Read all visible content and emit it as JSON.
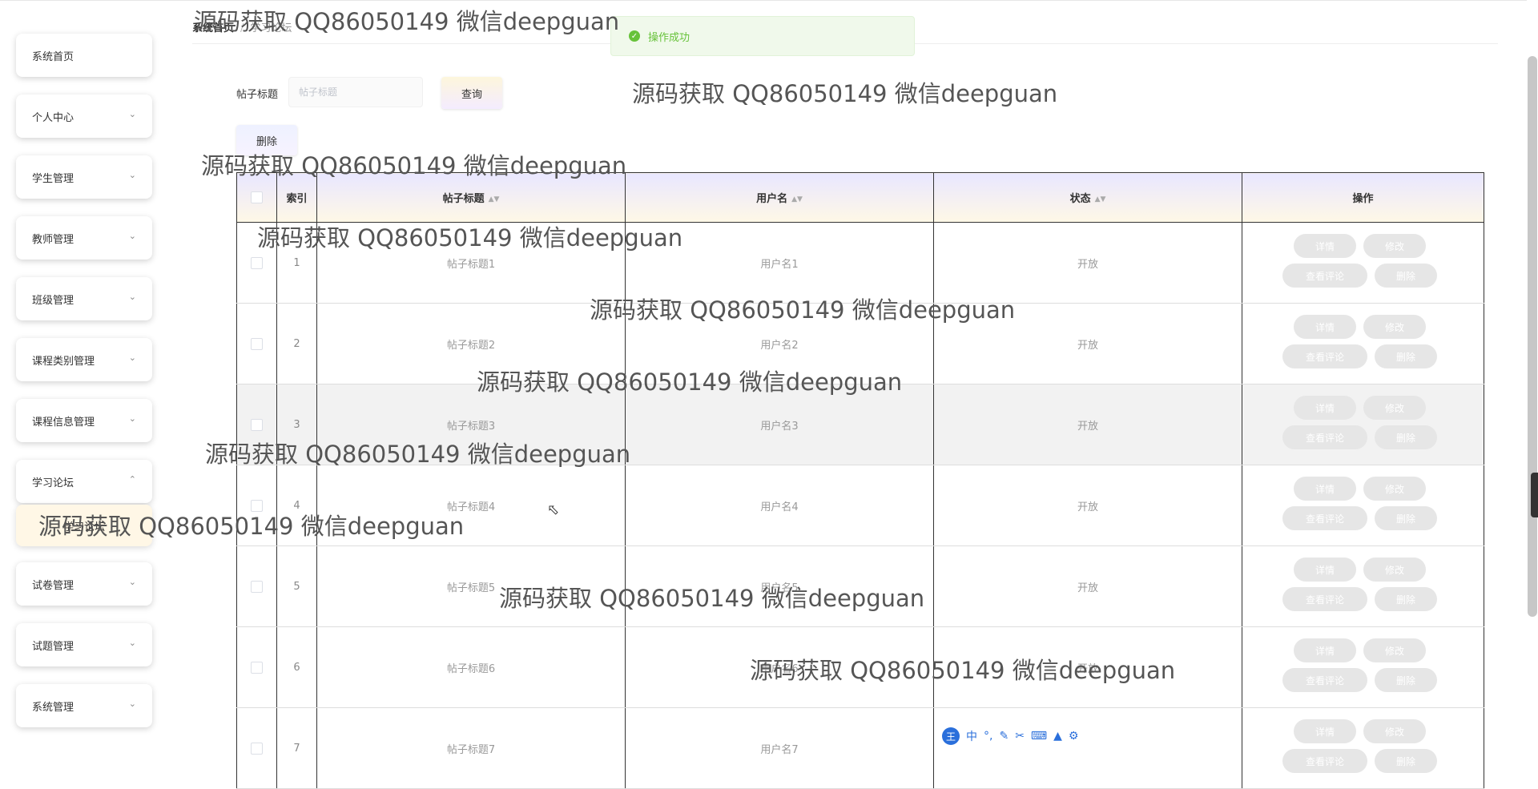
{
  "breadcrumb": {
    "home": "系统首页",
    "current": "学习论坛"
  },
  "toast": {
    "text": "操作成功"
  },
  "sidebar": {
    "items": [
      {
        "label": "系统首页",
        "has_arrow": false
      },
      {
        "label": "个人中心",
        "has_arrow": true
      },
      {
        "label": "学生管理",
        "has_arrow": true
      },
      {
        "label": "教师管理",
        "has_arrow": true
      },
      {
        "label": "班级管理",
        "has_arrow": true
      },
      {
        "label": "课程类别管理",
        "has_arrow": true
      },
      {
        "label": "课程信息管理",
        "has_arrow": true
      },
      {
        "label": "学习论坛",
        "has_arrow": true,
        "expanded": true
      },
      {
        "label": "试卷管理",
        "has_arrow": true
      },
      {
        "label": "试题管理",
        "has_arrow": true
      },
      {
        "label": "系统管理",
        "has_arrow": true
      }
    ],
    "sub_item": "学习论坛"
  },
  "search": {
    "label": "帖子标题",
    "placeholder": "帖子标题",
    "query_button": "查询",
    "delete_button": "删除"
  },
  "table": {
    "headers": {
      "index": "索引",
      "title": "帖子标题",
      "username": "用户名",
      "status": "状态",
      "actions": "操作"
    },
    "actions": {
      "detail": "详情",
      "edit": "修改",
      "comments": "查看评论",
      "delete": "删除"
    },
    "rows": [
      {
        "index": "1",
        "title": "帖子标题1",
        "username": "用户名1",
        "status": "开放"
      },
      {
        "index": "2",
        "title": "帖子标题2",
        "username": "用户名2",
        "status": "开放"
      },
      {
        "index": "3",
        "title": "帖子标题3",
        "username": "用户名3",
        "status": "开放"
      },
      {
        "index": "4",
        "title": "帖子标题4",
        "username": "用户名4",
        "status": "开放"
      },
      {
        "index": "5",
        "title": "帖子标题5",
        "username": "用户名5",
        "status": "开放"
      },
      {
        "index": "6",
        "title": "帖子标题6",
        "username": "用户名6",
        "status": "开放"
      },
      {
        "index": "7",
        "title": "帖子标题7",
        "username": "用户名7",
        "status": ""
      }
    ]
  },
  "watermark": "源码获取 QQ86050149 微信deepguan",
  "ime_toolbar": {
    "logo": "王",
    "lang": "中"
  },
  "colors": {
    "toast_green": "#67c23a",
    "header_gradient_top": "#e9e7ff",
    "header_gradient_bottom": "#fff8e6",
    "action_button": "#e6e6e6"
  }
}
